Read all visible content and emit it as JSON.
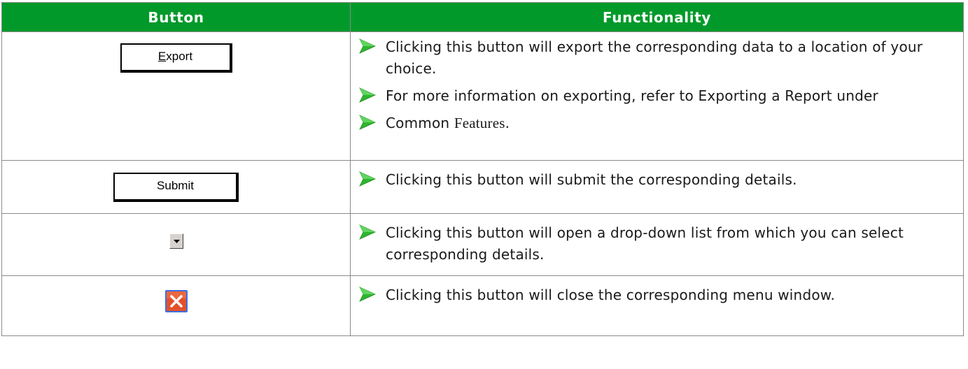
{
  "header": {
    "button_col": "Button",
    "functionality_col": "Functionality"
  },
  "rows": [
    {
      "button": {
        "type": "text-button",
        "label_underlined": "E",
        "label_rest": "xport",
        "icon": ""
      },
      "items": [
        {
          "text": "Clicking this button will export the corresponding data to a location of your choice."
        },
        {
          "text": "For more information on exporting, refer to Exporting a Report under"
        },
        {
          "text_prefix": "Common ",
          "text_serif": "Features",
          "text_suffix": "."
        }
      ]
    },
    {
      "button": {
        "type": "text-button",
        "label": "Submit"
      },
      "items": [
        {
          "text": "Clicking this button will submit the corresponding details."
        }
      ]
    },
    {
      "button": {
        "type": "icon-button",
        "icon": "dropdown-arrow-icon"
      },
      "items": [
        {
          "text": "Clicking this button will open a drop-down list from which you can select corresponding details."
        }
      ]
    },
    {
      "button": {
        "type": "icon-button",
        "icon": "close-x-icon"
      },
      "items": [
        {
          "text": "Clicking this button will close the corresponding menu window."
        }
      ]
    }
  ],
  "colors": {
    "header_bg": "#019a2a",
    "header_text": "#ffffff",
    "bullet_arrow": "#2fb52f",
    "close_icon_bg": "#e2522a",
    "close_icon_border": "#3a6ee8"
  }
}
